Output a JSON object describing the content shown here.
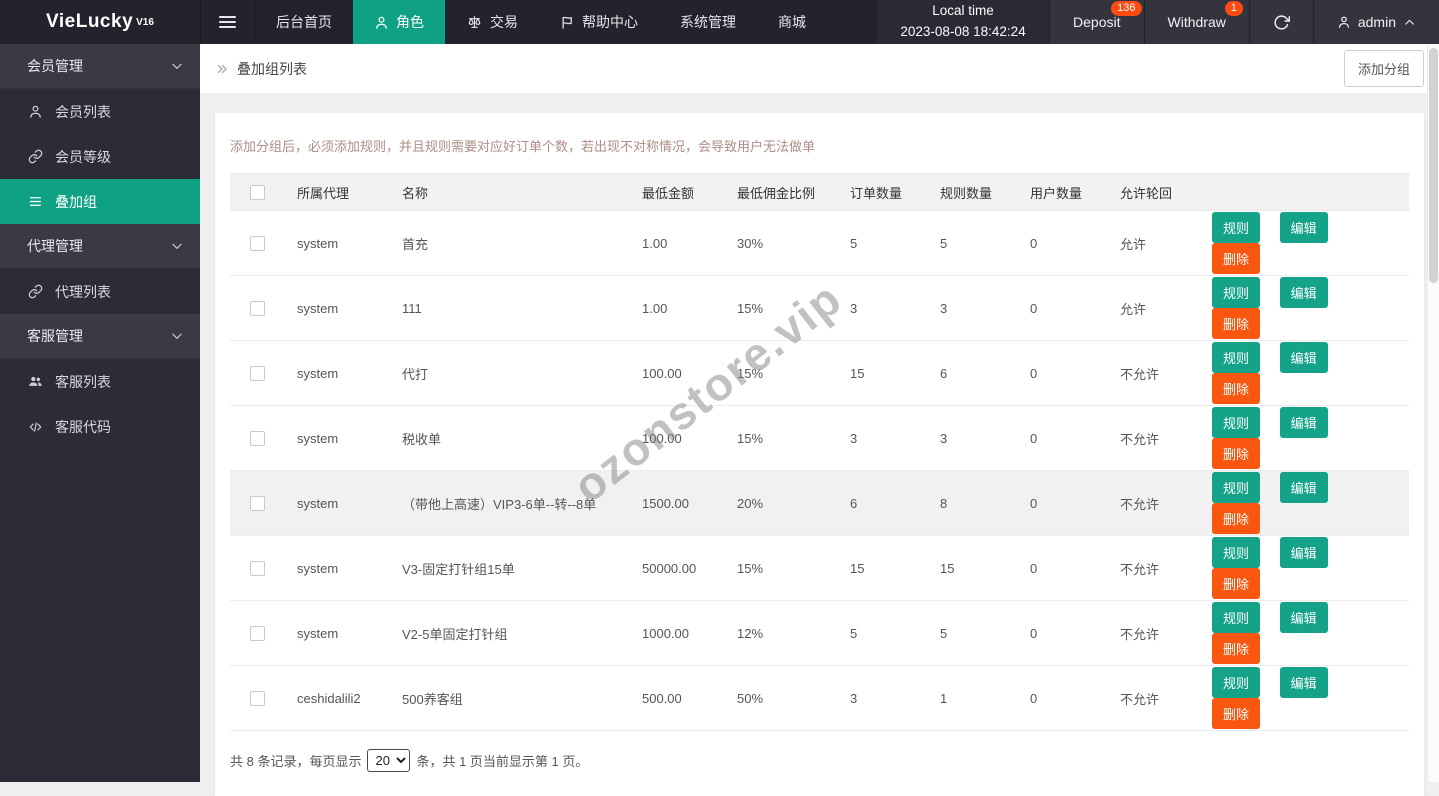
{
  "navbar": {
    "logo": "VieLucky",
    "version": "V16",
    "menu": {
      "home": "后台首页",
      "role": "角色",
      "trade": "交易",
      "help": "帮助中心",
      "system": "系统管理",
      "mall": "商城"
    },
    "local_time_label": "Local time",
    "local_time_value": "2023-08-08 18:42:24",
    "deposit": "Deposit",
    "deposit_badge": "136",
    "withdraw": "Withdraw",
    "withdraw_badge": "1",
    "user": "admin"
  },
  "sidebar": {
    "member_group": "会员管理",
    "member_list": "会员列表",
    "member_level": "会员等级",
    "stack_group": "叠加组",
    "agent_group": "代理管理",
    "agent_list": "代理列表",
    "service_group": "客服管理",
    "service_list": "客服列表",
    "service_code": "客服代码"
  },
  "breadcrumb": {
    "title": "叠加组列表"
  },
  "toolbar": {
    "add_button": "添加分组"
  },
  "page": {
    "hint": "添加分组后，必须添加规则，并且规则需要对应好订单个数，若出现不对称情况，会导致用户无法做单"
  },
  "table": {
    "headers": {
      "agent": "所属代理",
      "name": "名称",
      "min_amount": "最低金额",
      "min_commission": "最低佣金比例",
      "order_count": "订单数量",
      "rule_count": "规则数量",
      "user_count": "用户数量",
      "allow_loop": "允许轮回"
    },
    "actions": {
      "rule": "规则",
      "edit": "编辑",
      "del": "删除"
    },
    "rows": [
      {
        "agent": "system",
        "name": "首充",
        "min_amount": "1.00",
        "min_commission": "30%",
        "order_count": "5",
        "rule_count": "5",
        "user_count": "0",
        "allow_loop": "允许"
      },
      {
        "agent": "system",
        "name": "111",
        "min_amount": "1.00",
        "min_commission": "15%",
        "order_count": "3",
        "rule_count": "3",
        "user_count": "0",
        "allow_loop": "允许"
      },
      {
        "agent": "system",
        "name": "代打",
        "min_amount": "100.00",
        "min_commission": "15%",
        "order_count": "15",
        "rule_count": "6",
        "user_count": "0",
        "allow_loop": "不允许"
      },
      {
        "agent": "system",
        "name": "税收单",
        "min_amount": "100.00",
        "min_commission": "15%",
        "order_count": "3",
        "rule_count": "3",
        "user_count": "0",
        "allow_loop": "不允许"
      },
      {
        "agent": "system",
        "name": "（带他上高速）VIP3-6单--转--8单",
        "min_amount": "1500.00",
        "min_commission": "20%",
        "order_count": "6",
        "rule_count": "8",
        "user_count": "0",
        "allow_loop": "不允许"
      },
      {
        "agent": "system",
        "name": "V3-固定打针组15单",
        "min_amount": "50000.00",
        "min_commission": "15%",
        "order_count": "15",
        "rule_count": "15",
        "user_count": "0",
        "allow_loop": "不允许"
      },
      {
        "agent": "system",
        "name": "V2-5单固定打针组",
        "min_amount": "1000.00",
        "min_commission": "12%",
        "order_count": "5",
        "rule_count": "5",
        "user_count": "0",
        "allow_loop": "不允许"
      },
      {
        "agent": "ceshidalili2",
        "name": "500养客组",
        "min_amount": "500.00",
        "min_commission": "50%",
        "order_count": "3",
        "rule_count": "1",
        "user_count": "0",
        "allow_loop": "不允许"
      }
    ]
  },
  "pagination": {
    "part1": "共 8 条记录，每页显示",
    "page_size": "20",
    "part2": "条，共 1 页当前显示第 1 页。"
  },
  "watermark": {
    "text": "ozonstore.vip"
  },
  "colors": {
    "accent": "#0ea183",
    "danger": "#f9560f",
    "badge": "#ff4a11",
    "navbar": "#23232e",
    "sidebar": "#2c2c37"
  }
}
